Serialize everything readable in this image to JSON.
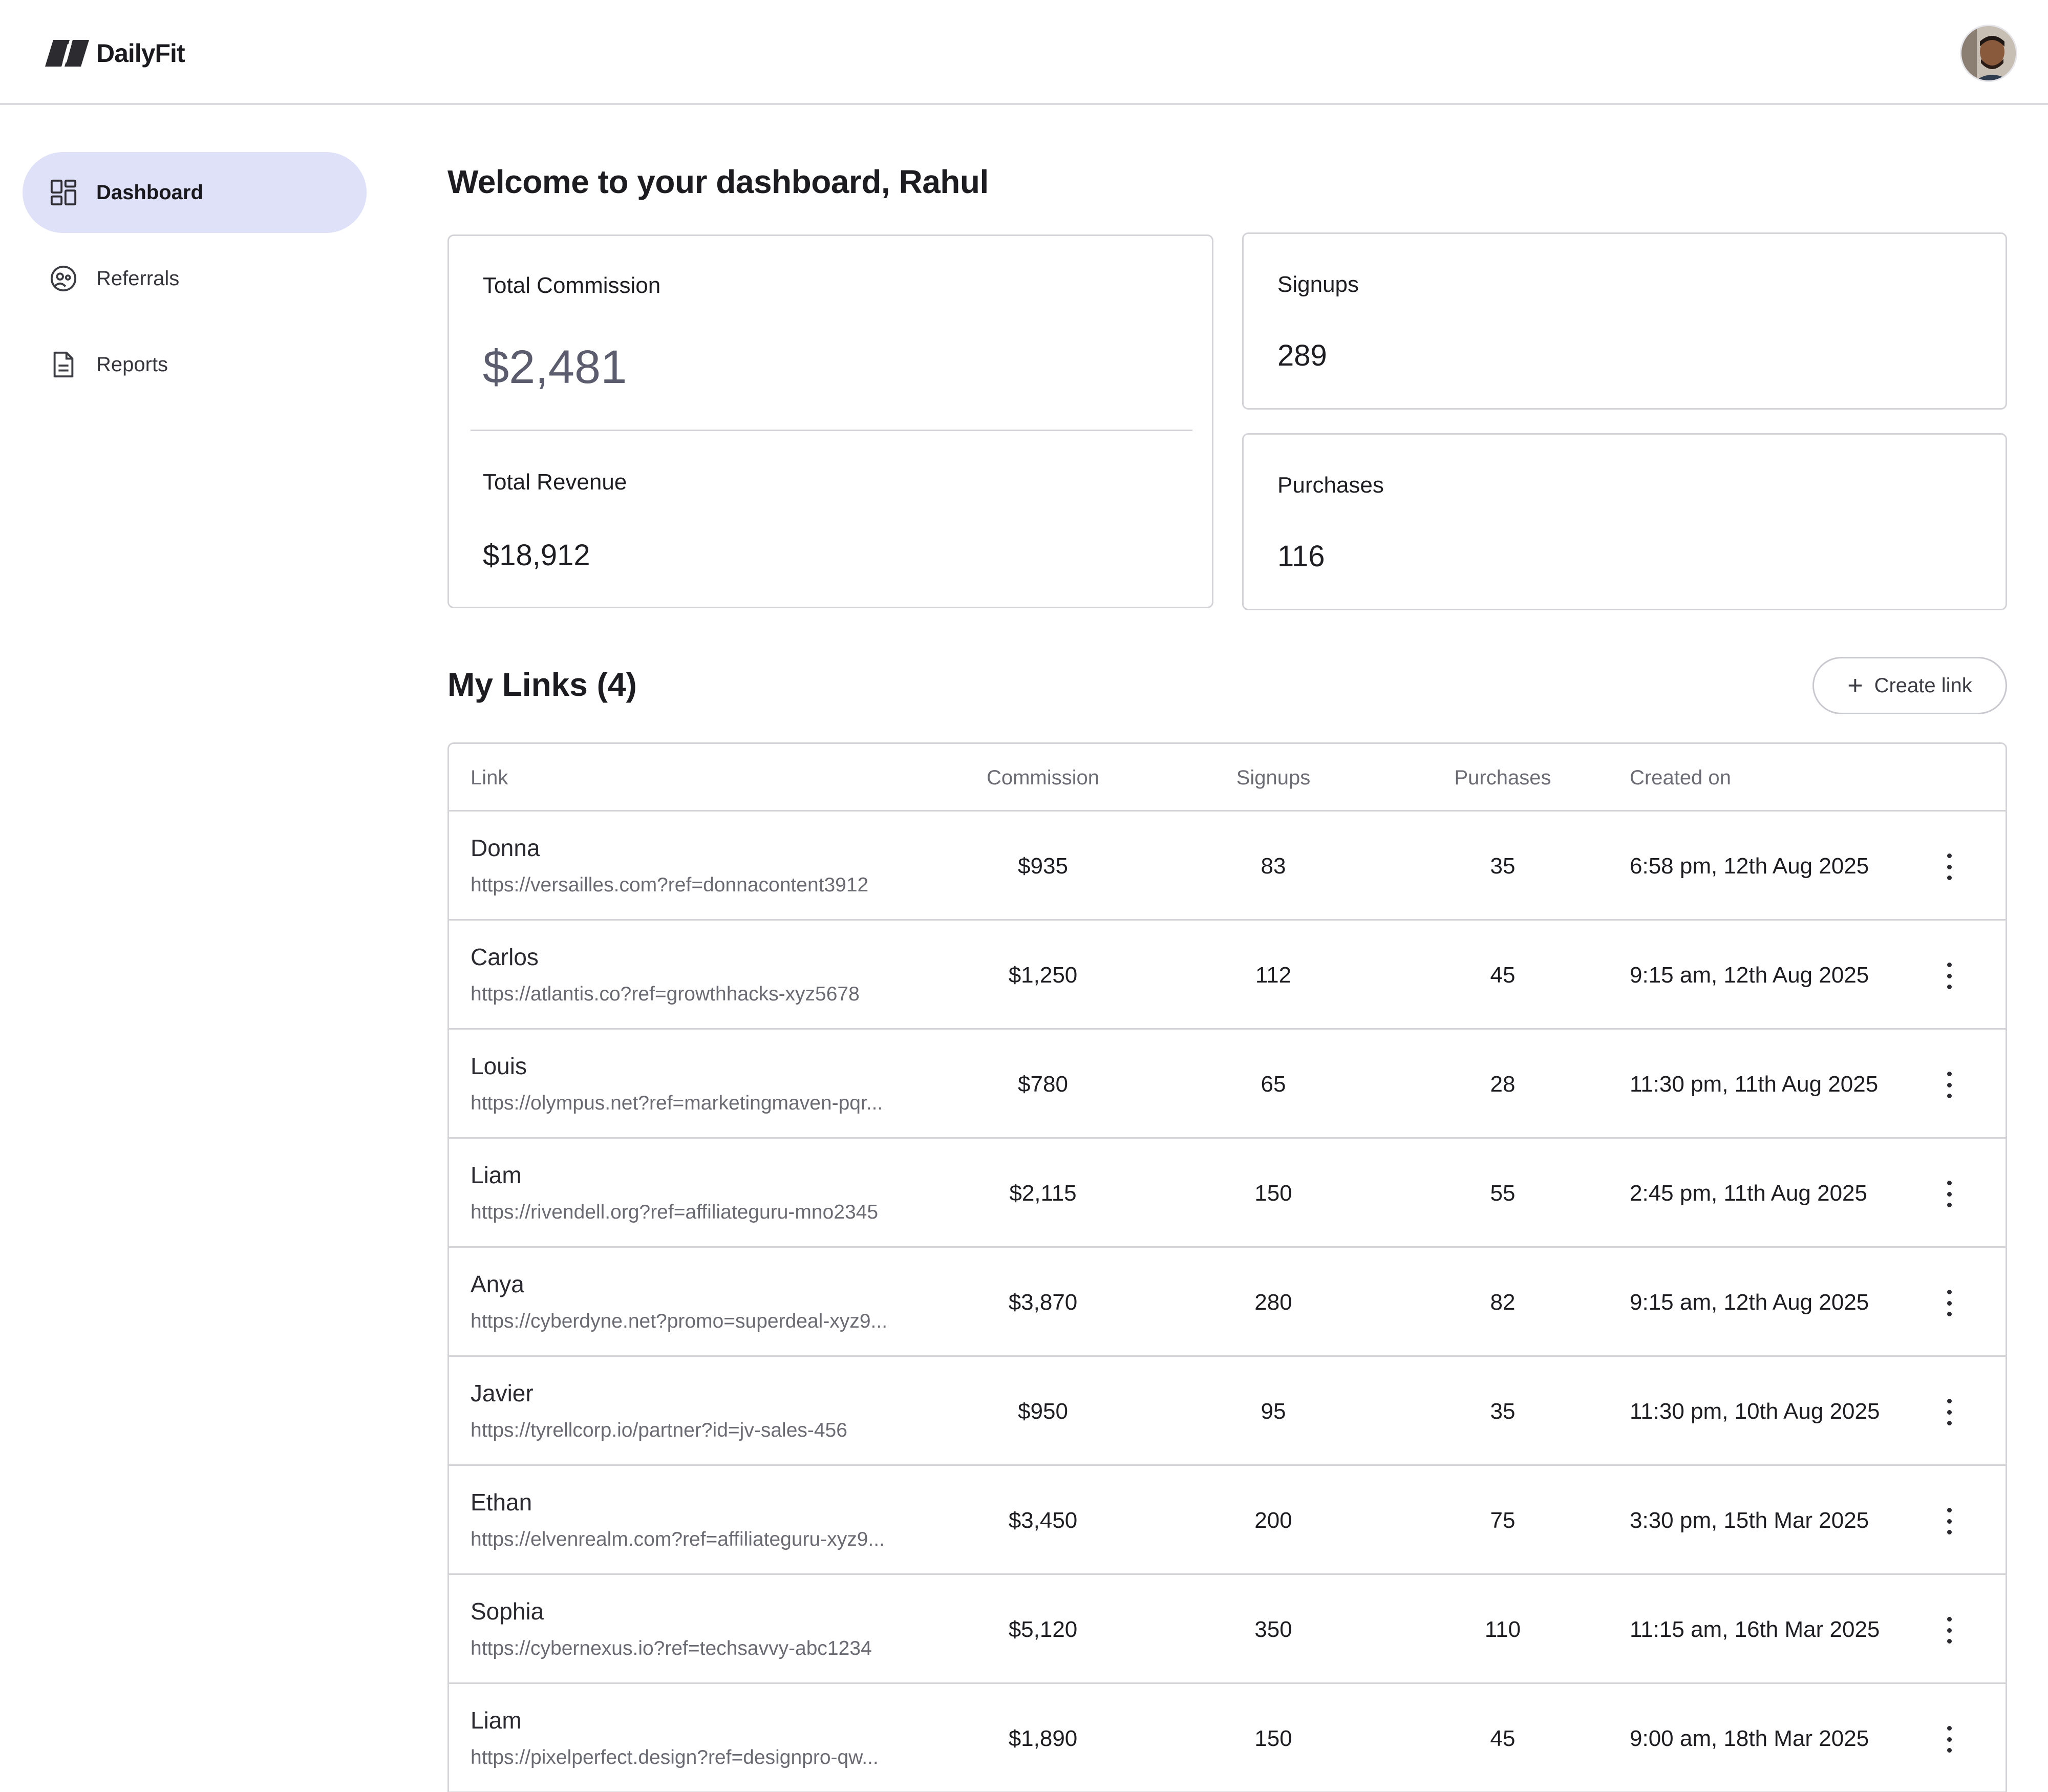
{
  "app": {
    "brand_name": "DailyFit"
  },
  "sidebar": {
    "items": [
      {
        "label": "Dashboard",
        "icon": "dashboard-grid-icon",
        "active": true
      },
      {
        "label": "Referrals",
        "icon": "referrals-icon",
        "active": false
      },
      {
        "label": "Reports",
        "icon": "document-icon",
        "active": false
      }
    ]
  },
  "main": {
    "welcome": "Welcome to your dashboard, Rahul",
    "stats": {
      "total_commission": {
        "label": "Total Commission",
        "value": "$2,481"
      },
      "total_revenue": {
        "label": "Total Revenue",
        "value": "$18,912"
      },
      "signups": {
        "label": "Signups",
        "value": "289"
      },
      "purchases": {
        "label": "Purchases",
        "value": "116"
      }
    },
    "links_title": "My Links (4)",
    "create_link_label": "Create link",
    "table": {
      "headers": {
        "link": "Link",
        "commission": "Commission",
        "signups": "Signups",
        "purchases": "Purchases",
        "created_on": "Created on"
      },
      "rows": [
        {
          "name": "Donna",
          "url": "https://versailles.com?ref=donnacontent3912",
          "commission": "$935",
          "signups": "83",
          "purchases": "35",
          "created_on": "6:58 pm, 12th Aug 2025"
        },
        {
          "name": "Carlos",
          "url": "https://atlantis.co?ref=growthhacks-xyz5678",
          "commission": "$1,250",
          "signups": "112",
          "purchases": "45",
          "created_on": "9:15 am, 12th Aug 2025"
        },
        {
          "name": "Louis",
          "url": "https://olympus.net?ref=marketingmaven-pqr...",
          "commission": "$780",
          "signups": "65",
          "purchases": "28",
          "created_on": "11:30 pm, 11th Aug 2025"
        },
        {
          "name": "Liam",
          "url": "https://rivendell.org?ref=affiliateguru-mno2345",
          "commission": "$2,115",
          "signups": "150",
          "purchases": "55",
          "created_on": "2:45 pm, 11th Aug 2025"
        },
        {
          "name": "Anya",
          "url": "https://cyberdyne.net?promo=superdeal-xyz9...",
          "commission": "$3,870",
          "signups": "280",
          "purchases": "82",
          "created_on": "9:15 am, 12th Aug 2025"
        },
        {
          "name": "Javier",
          "url": "https://tyrellcorp.io/partner?id=jv-sales-456",
          "commission": "$950",
          "signups": "95",
          "purchases": "35",
          "created_on": "11:30 pm, 10th Aug 2025"
        },
        {
          "name": "Ethan",
          "url": "https://elvenrealm.com?ref=affiliateguru-xyz9...",
          "commission": "$3,450",
          "signups": "200",
          "purchases": "75",
          "created_on": "3:30 pm, 15th Mar 2025"
        },
        {
          "name": "Sophia",
          "url": "https://cybernexus.io?ref=techsavvy-abc1234",
          "commission": "$5,120",
          "signups": "350",
          "purchases": "110",
          "created_on": "11:15 am, 16th Mar 2025"
        },
        {
          "name": "Liam",
          "url": "https://pixelperfect.design?ref=designpro-qw...",
          "commission": "$1,890",
          "signups": "150",
          "purchases": "45",
          "created_on": "9:00 am, 18th Mar 2025"
        }
      ]
    }
  },
  "colors": {
    "accent_active_nav": "#dfe1f8",
    "border": "#d3d3d8",
    "muted_text": "#6a6a72",
    "big_value": "#5b5d6e"
  }
}
